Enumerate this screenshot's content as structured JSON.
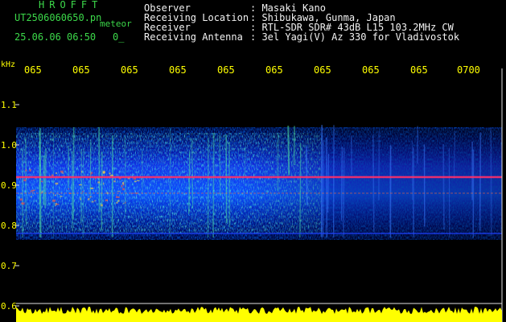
{
  "header": {
    "title": "HROFFT",
    "filename": "UT2506060650.pn",
    "meteor_label": "meteor",
    "datetime": "25.06.06 06:50",
    "count": "0_",
    "fields": [
      {
        "label": "Observer",
        "value": ": Masaki Kano"
      },
      {
        "label": "Receiving Location",
        "value": ": Shibukawa, Gunma, Japan"
      },
      {
        "label": "Receiver",
        "value": ": RTL-SDR SDR# 43dB L15 103.2MHz CW"
      },
      {
        "label": "Receiving Antenna",
        "value": ": 3el Yagi(V) Az 330 for Vladivostok"
      }
    ]
  },
  "spectrogram": {
    "y_unit": "kHz",
    "y_ticks": [
      "1.1",
      "1.0",
      "0.9",
      "0.8",
      "0.7",
      "0.6"
    ],
    "x_ticks": [
      "065",
      "065",
      "065",
      "065",
      "065",
      "065",
      "065",
      "065",
      "065",
      "0700"
    ],
    "colors": {
      "background": "#000000",
      "text_header": "#3cd94a",
      "text_info": "#f2f2f2",
      "ticks": "#ffff00",
      "signal_line": "#ff2f6a",
      "noise_floor": "#ffff00"
    }
  }
}
